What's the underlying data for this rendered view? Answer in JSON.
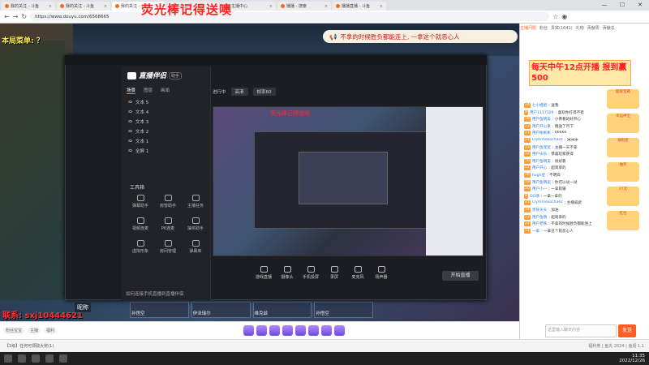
{
  "browser": {
    "tabs": [
      {
        "label": "我的关注 - 斗鱼",
        "active": false
      },
      {
        "label": "我的关注 - 斗鱼",
        "active": false
      },
      {
        "label": "我的关注 - 斗鱼",
        "active": true
      },
      {
        "label": "斗鱼直播",
        "active": false
      },
      {
        "label": "主播中心",
        "active": false
      },
      {
        "label": "播播 - 搜索",
        "active": false
      },
      {
        "label": "播播直播 - 斗鱼",
        "active": false
      }
    ],
    "url": "https://www.douyu.com/6568665",
    "min_label": "—",
    "max_label": "☐",
    "close_label": "✕"
  },
  "overlay_title": "荧光棒记得送噢",
  "game": {
    "menu_label": "本局菜单: ？",
    "banner_text": "不拿的时候胜负都能连上, 一拿这个就恶心人",
    "score": "13750",
    "bottom_name": "联系: sxj10444621",
    "name_tag": "昵称",
    "heroes": [
      "孙悟空",
      "伊泽瑞尔",
      "维克兹",
      "孙悟空"
    ]
  },
  "app": {
    "brand": "直播伴侣",
    "version": "助手",
    "side_tabs": [
      "场景",
      "图层",
      "画面"
    ],
    "scenes": [
      "文本 5",
      "文本 4",
      "文本 3",
      "文本 2",
      "文本 1",
      "全屏 1"
    ],
    "tools_label": "工具箱",
    "tools": [
      "弹幕助手",
      "房管助手",
      "主播任务",
      "视频连麦",
      "PK连麦",
      "抽奖助手",
      "虚拟形象",
      "房间管理",
      "弹幕库"
    ],
    "tooltip": "如何连接手机直播到直播伴侣",
    "topbar": {
      "label": "进行中",
      "sel1": "高清",
      "sel2": "帧率60"
    },
    "preview_overlay": "荧光棒记得送噢",
    "controls": [
      "游戏直播",
      "摄像头",
      "手机投屏",
      "录屏",
      "麦克风",
      "扬声器"
    ],
    "start_label": "开始直播"
  },
  "chat": {
    "tabs": [
      "主播问题",
      "粉丝",
      "贵宾(1641)",
      "礼物",
      "贡献周",
      "贡献总"
    ],
    "promo": "每天中午12点开播 报到赢500",
    "messages": [
      {
        "lv": "14",
        "name": "七小姐姐",
        "text": ": 送我"
      },
      {
        "lv": "9",
        "name": "用户1117129",
        "text": ": 喜欢你打得不错"
      },
      {
        "lv": "18",
        "name": "用户鱼晴美",
        "text": ": 小青看的好开心"
      },
      {
        "lv": "13",
        "name": "用户开心果",
        "text": ": 赠送了月下"
      },
      {
        "lv": "11",
        "name": "用户彬彬彬",
        "text": ": 66666"
      },
      {
        "lv": "21",
        "name": "Clymmekochaez",
        "text": ": 冲冲冲"
      },
      {
        "lv": "15",
        "name": "用户鱼宠宠",
        "text": ": 主播一天不拿"
      },
      {
        "lv": "12",
        "name": "用户乐乐",
        "text": ": 恭喜玩家获得"
      },
      {
        "lv": "10",
        "name": "用户鱼晴美",
        "text": ": 很好看"
      },
      {
        "lv": "17",
        "name": "用户开心",
        "text": ": 超简单的"
      },
      {
        "lv": "16",
        "name": "hugh星",
        "text": ": 不明白"
      },
      {
        "lv": "19",
        "name": "用户鱼晴美",
        "text": ": 你可以试一试"
      },
      {
        "lv": "20",
        "name": "用户小一",
        "text": ": 一拿就输"
      },
      {
        "lv": "8",
        "name": "OG晴",
        "text": ": 一拿一拿的"
      },
      {
        "lv": "21",
        "name": "Clymmekochaez",
        "text": ": 主播威武"
      },
      {
        "lv": "14",
        "name": "贵族天天",
        "text": ": 加油"
      },
      {
        "lv": "13",
        "name": "用户鱼晴",
        "text": ": 超简单的"
      },
      {
        "lv": "22",
        "name": "用户老铁",
        "text": ": 不拿的时候胜负都能连上"
      },
      {
        "lv": "11",
        "name": "一拿",
        "text": ": 一拿这个就恶心人"
      }
    ],
    "ads": [
      "超级宝箱",
      "幸运神宝",
      "福利屋",
      "抽奖",
      "37次",
      "红包"
    ],
    "input_placeholder": "这里输入聊天内容",
    "send_label": "发送"
  },
  "giftbar": {
    "pills": [
      "粉丝宝宝",
      "主播",
      "福利"
    ]
  },
  "status": {
    "note": "【1级】任何可领取大奖(1)",
    "right": "福利券 | 鱼丸 2024 | 鱼翅 1.1"
  },
  "taskbar": {
    "time": "11:35",
    "date": "2022/12/26"
  }
}
